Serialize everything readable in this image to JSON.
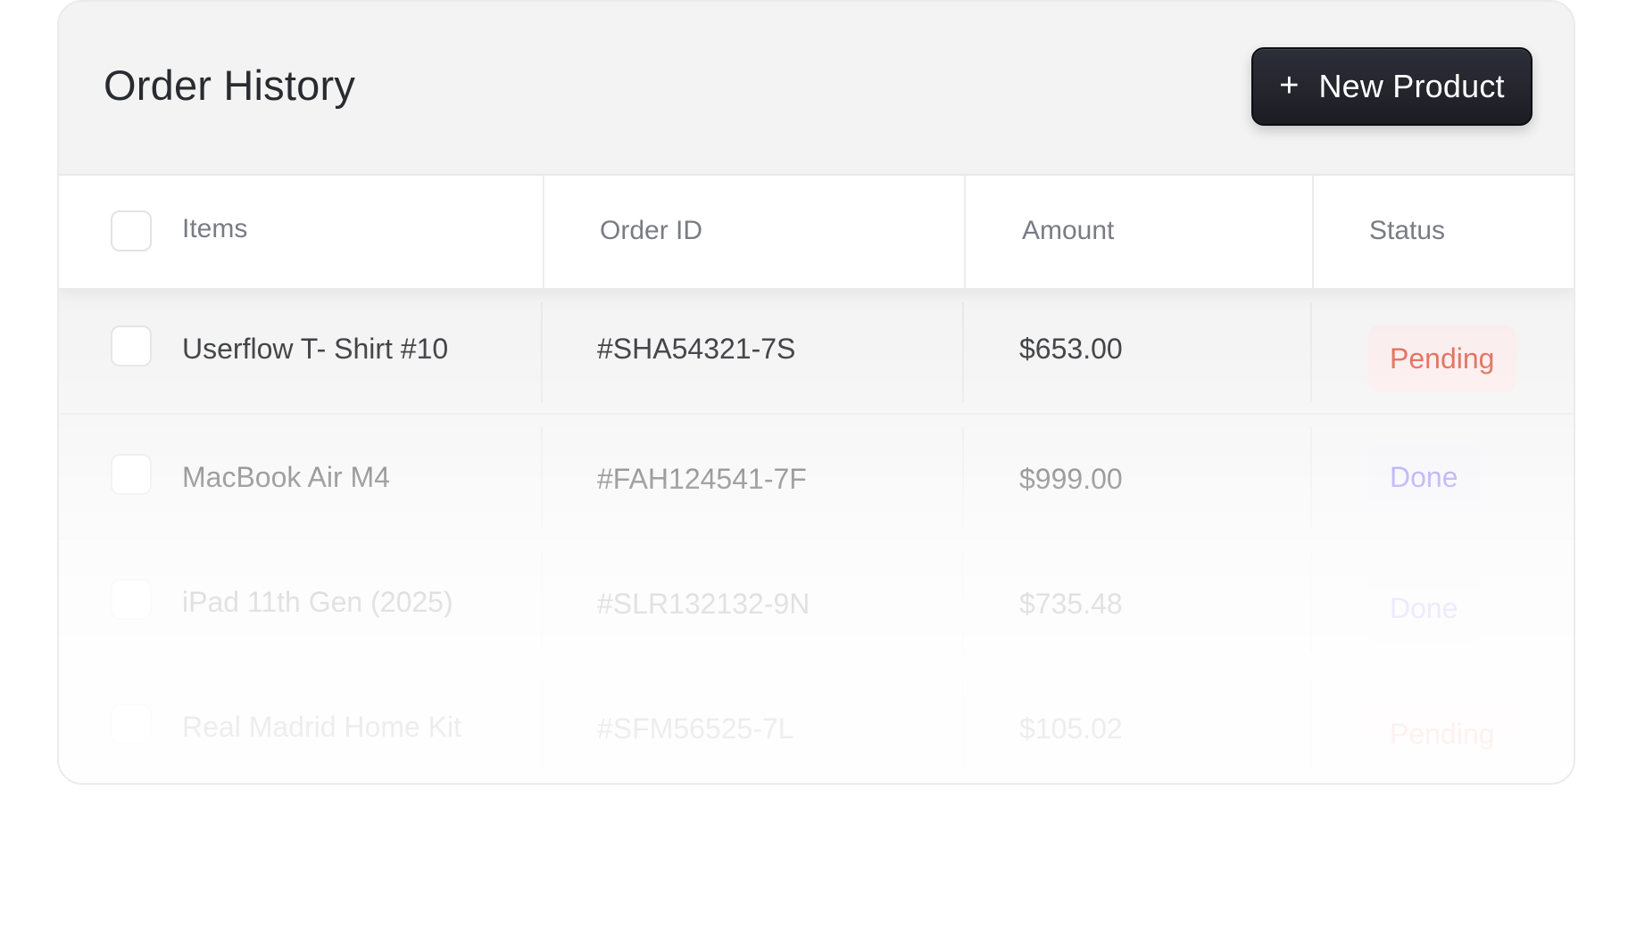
{
  "header": {
    "title": "Order History",
    "new_button": {
      "icon": "plus-icon",
      "plus": "+",
      "label": "New Product"
    }
  },
  "table": {
    "columns": [
      "Items",
      "Order ID",
      "Amount",
      "Status"
    ],
    "rows": [
      {
        "item": "Userflow T- Shirt #10",
        "order_id": "#SHA54321-7S",
        "amount": "$653.00",
        "status": "Pending"
      },
      {
        "item": "MacBook Air M4",
        "order_id": "#FAH124541-7F",
        "amount": "$999.00",
        "status": "Done"
      },
      {
        "item": "iPad 11th Gen (2025)",
        "order_id": "#SLR132132-9N",
        "amount": "$735.48",
        "status": "Done"
      },
      {
        "item": "Real Madrid Home Kit",
        "order_id": "#SFM56525-7L",
        "amount": "$105.02",
        "status": "Pending"
      }
    ]
  },
  "colors": {
    "button_bg": "#1c1d24",
    "pending_text": "#e0604b",
    "pending_bg": "#fbecec",
    "done_text": "#7b6cf0",
    "done_bg": "#f1f1f6"
  }
}
